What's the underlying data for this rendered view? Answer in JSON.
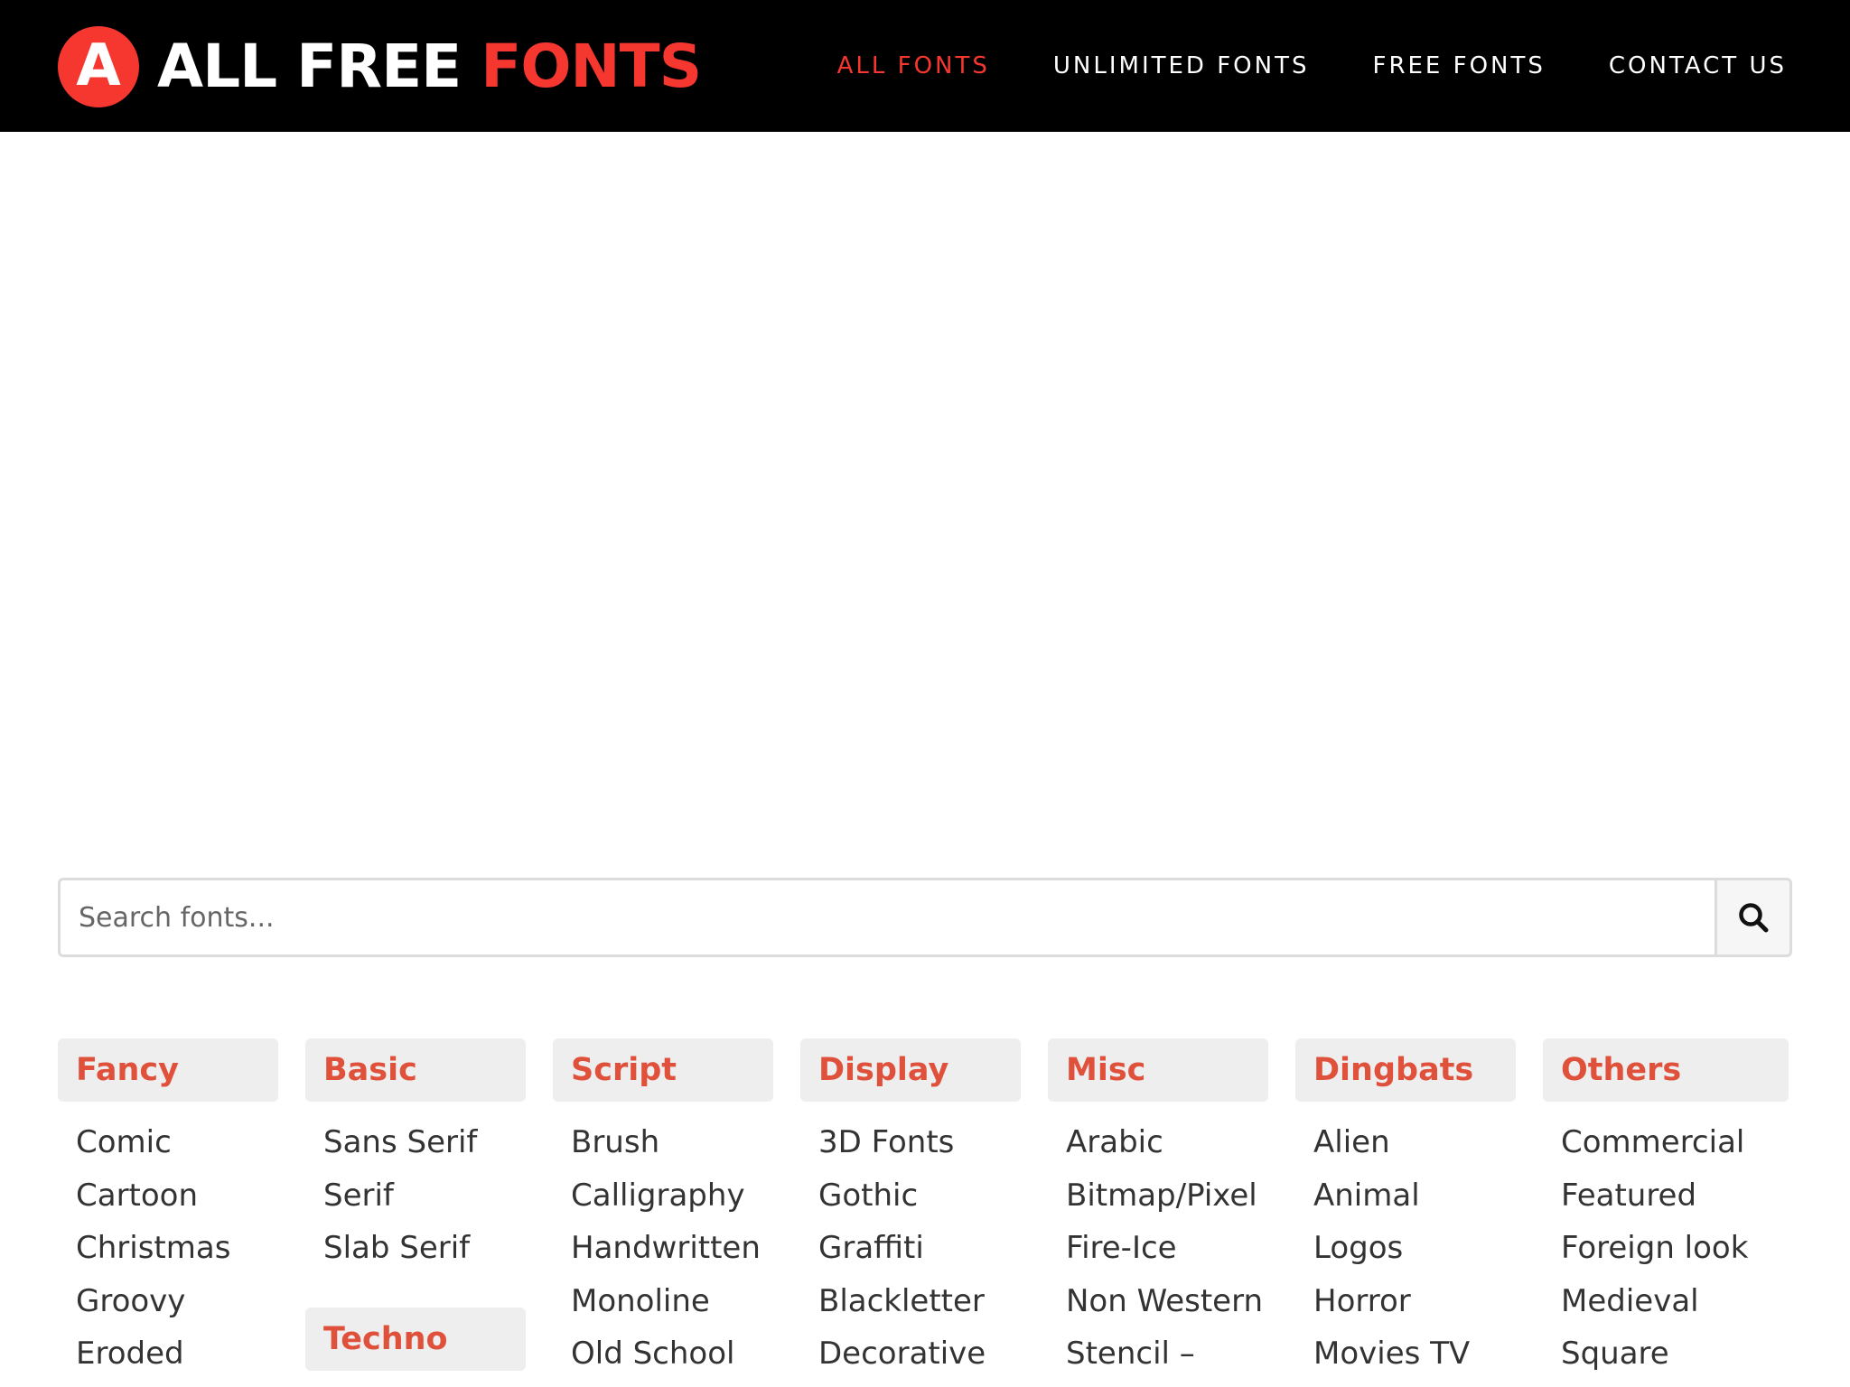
{
  "header": {
    "logo_letter": "A",
    "logo_text_white": "ALL FREE",
    "logo_text_red": "FONTS",
    "nav": [
      {
        "label": "ALL FONTS",
        "active": true
      },
      {
        "label": "UNLIMITED FONTS"
      },
      {
        "label": "FREE FONTS"
      },
      {
        "label": "CONTACT US"
      }
    ]
  },
  "search": {
    "placeholder": "Search fonts...",
    "button_icon": "search-icon"
  },
  "colors": {
    "brand_red": "#f5372f",
    "category_red": "#e0513c",
    "header_bg": "#000000",
    "category_bg": "#eeeeee"
  },
  "categories": [
    {
      "title": "Fancy",
      "items": [
        "Comic",
        "Cartoon",
        "Christmas",
        "Groovy",
        "Eroded"
      ]
    },
    {
      "title": "Basic",
      "items": [
        "Sans Serif",
        "Serif",
        "Slab Serif"
      ],
      "sub": {
        "title": "Techno"
      }
    },
    {
      "title": "Script",
      "items": [
        "Brush",
        "Calligraphy",
        "Handwritten",
        "Monoline",
        "Old School"
      ]
    },
    {
      "title": "Display",
      "items": [
        "3D Fonts",
        "Gothic",
        "Graffiti",
        "Blackletter",
        "Decorative"
      ]
    },
    {
      "title": "Misc",
      "items": [
        "Arabic",
        "Bitmap/Pixel",
        "Fire-Ice",
        "Non Western",
        "Stencil –"
      ]
    },
    {
      "title": "Dingbats",
      "items": [
        "Alien",
        "Animal",
        "Logos",
        "Horror",
        "Movies TV"
      ]
    },
    {
      "title": "Others",
      "items": [
        "Commercial",
        "Featured",
        "Foreign look",
        "Medieval",
        "Square"
      ]
    }
  ]
}
